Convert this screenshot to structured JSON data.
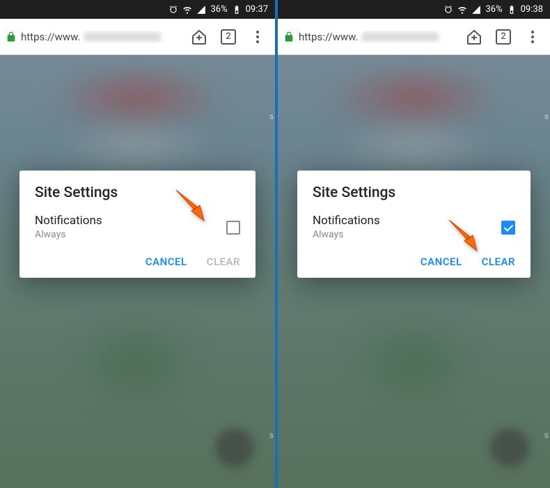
{
  "left": {
    "status": {
      "time": "09:37",
      "battery": "36%"
    },
    "url": {
      "protocol": "https://www.",
      "tab_count": "2"
    },
    "dialog": {
      "title": "Site Settings",
      "notif_label": "Notifications",
      "notif_sub": "Always",
      "checked": false,
      "cancel": "CANCEL",
      "clear": "CLEAR",
      "clear_enabled": false
    }
  },
  "right": {
    "status": {
      "time": "09:38",
      "battery": "36%"
    },
    "url": {
      "protocol": "https://www.",
      "tab_count": "2"
    },
    "dialog": {
      "title": "Site Settings",
      "notif_label": "Notifications",
      "notif_sub": "Always",
      "checked": true,
      "cancel": "CANCEL",
      "clear": "CLEAR",
      "clear_enabled": true
    }
  },
  "colors": {
    "accent": "#1a8cff",
    "arrow": "#ff6a00"
  }
}
